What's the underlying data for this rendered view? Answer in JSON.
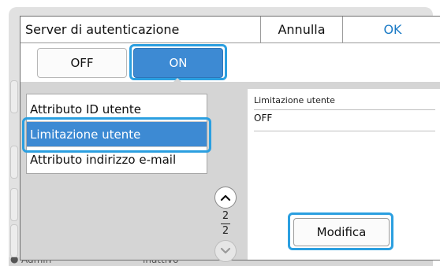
{
  "dialog": {
    "title": "Server di autenticazione",
    "cancel_label": "Annulla",
    "ok_label": "OK"
  },
  "toggle": {
    "off_label": "OFF",
    "on_label": "ON",
    "selected": "ON"
  },
  "list": {
    "items": [
      {
        "label": "Attributo ID utente",
        "selected": false
      },
      {
        "label": "Limitazione utente",
        "selected": true
      },
      {
        "label": "Attributo indirizzo e-mail",
        "selected": false
      }
    ]
  },
  "pager": {
    "current": "2",
    "total": "2",
    "up_icon": "chevron-up-icon",
    "down_icon": "chevron-down-icon"
  },
  "detail": {
    "label": "Limitazione utente",
    "value": "OFF",
    "edit_label": "Modifica"
  },
  "background": {
    "bottom_left": "Admin",
    "bottom_mid": "inattivo"
  },
  "colors": {
    "accent": "#3d8ad3",
    "focus": "#2b9fe0",
    "ok_text": "#1c7bc6"
  }
}
